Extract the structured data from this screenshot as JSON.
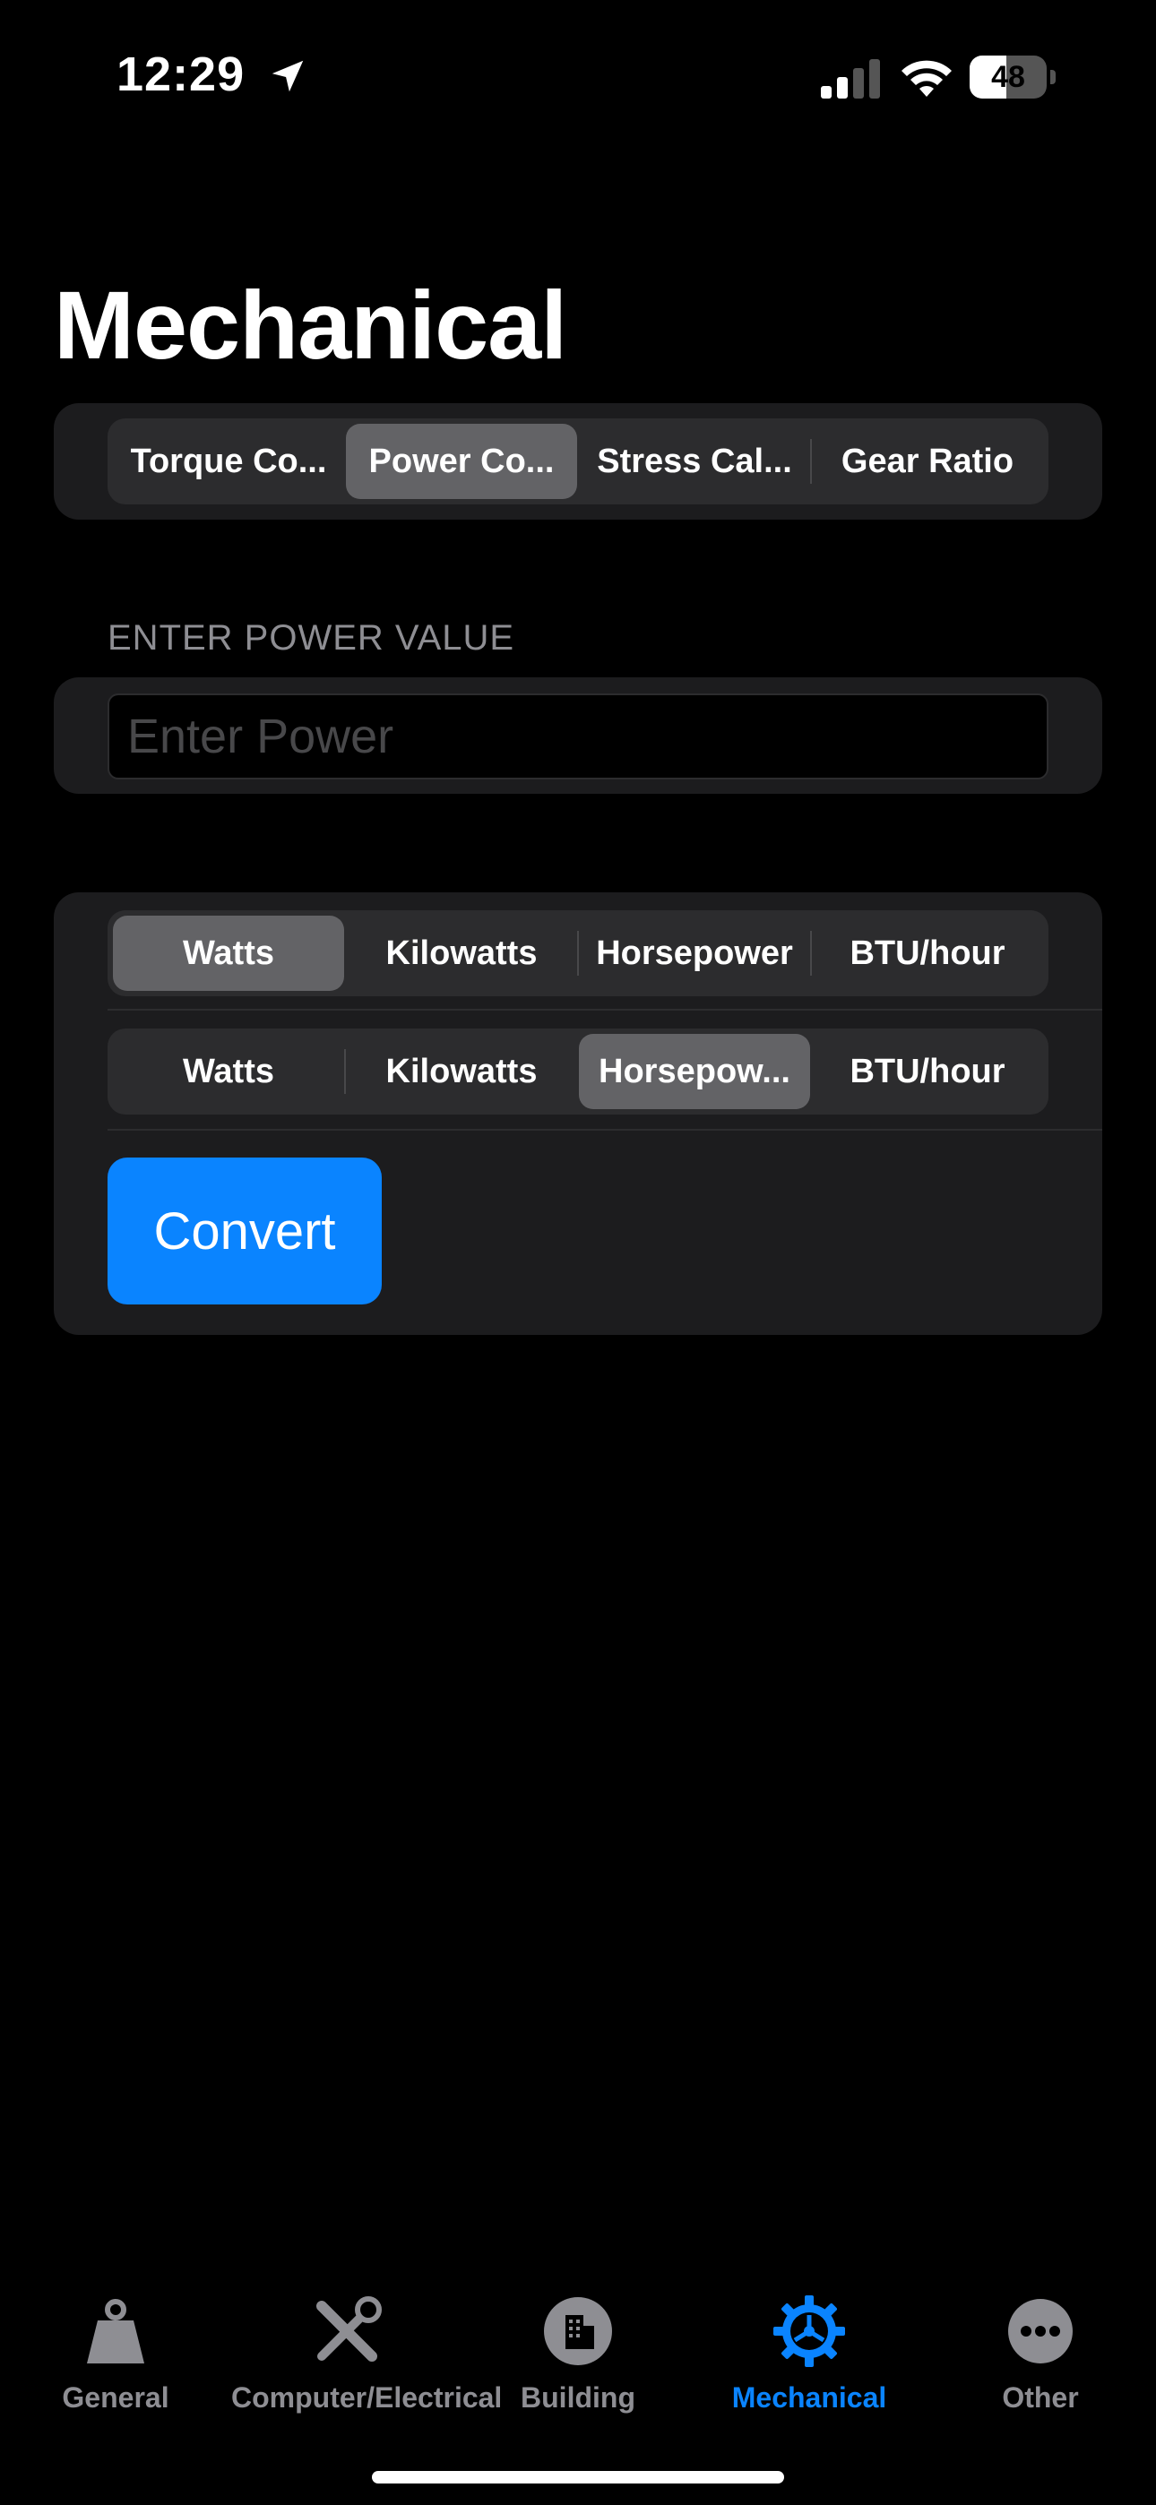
{
  "status": {
    "time": "12:29",
    "battery": "48",
    "battery_level": 0.48
  },
  "page": {
    "title": "Mechanical"
  },
  "calculator_tabs": [
    {
      "label": "Torque Co...",
      "selected": false
    },
    {
      "label": "Power Co...",
      "selected": true
    },
    {
      "label": "Stress Cal...",
      "selected": false
    },
    {
      "label": "Gear Ratio",
      "selected": false
    }
  ],
  "power_input": {
    "section_label": "ENTER POWER VALUE",
    "placeholder": "Enter Power",
    "value": ""
  },
  "from_units": [
    {
      "label": "Watts",
      "selected": true
    },
    {
      "label": "Kilowatts",
      "selected": false
    },
    {
      "label": "Horsepower",
      "selected": false
    },
    {
      "label": "BTU/hour",
      "selected": false
    }
  ],
  "to_units": [
    {
      "label": "Watts",
      "selected": false
    },
    {
      "label": "Kilowatts",
      "selected": false
    },
    {
      "label": "Horsepow...",
      "selected": true
    },
    {
      "label": "BTU/hour",
      "selected": false
    }
  ],
  "convert_button": {
    "label": "Convert"
  },
  "tab_bar": [
    {
      "label": "General",
      "icon": "weight-icon",
      "active": false
    },
    {
      "label": "Computer/Electrical",
      "icon": "tools-icon",
      "active": false
    },
    {
      "label": "Building",
      "icon": "building-icon",
      "active": false
    },
    {
      "label": "Mechanical",
      "icon": "gear-icon",
      "active": true
    },
    {
      "label": "Other",
      "icon": "ellipsis-icon",
      "active": false
    }
  ],
  "colors": {
    "accent": "#0a84ff",
    "background": "#000000",
    "card": "#1c1c1e",
    "segment_selected": "#636366"
  }
}
